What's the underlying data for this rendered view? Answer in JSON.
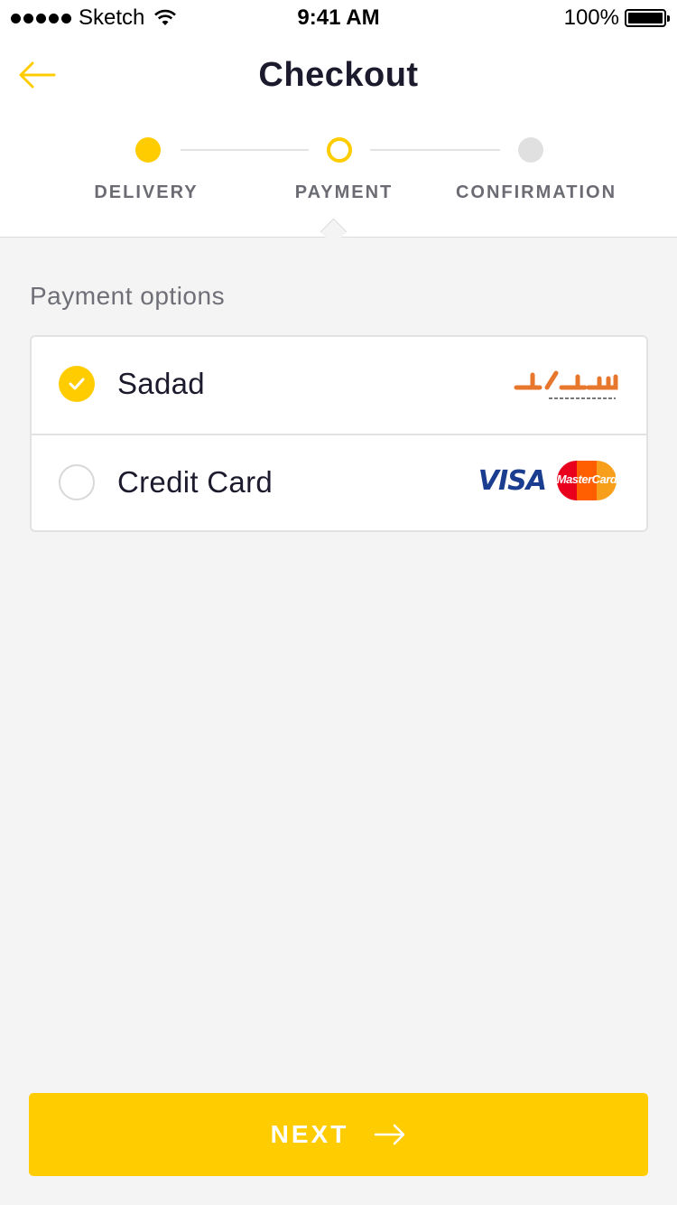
{
  "status_bar": {
    "carrier": "Sketch",
    "time": "9:41 AM",
    "battery": "100%"
  },
  "header": {
    "title": "Checkout"
  },
  "steps": [
    {
      "label": "DELIVERY",
      "state": "done"
    },
    {
      "label": "PAYMENT",
      "state": "active"
    },
    {
      "label": "CONFIRMATION",
      "state": "todo"
    }
  ],
  "payment": {
    "section_title": "Payment options",
    "options": [
      {
        "label": "Sadad",
        "selected": true,
        "logo": "sadad-logo"
      },
      {
        "label": "Credit Card",
        "selected": false,
        "logo": "visa-mastercard-logos",
        "visa_text": "VISA",
        "mastercard_text": "MasterCard"
      }
    ]
  },
  "footer": {
    "next_label": "NEXT"
  },
  "colors": {
    "accent": "#ffcc00",
    "text": "#1c1b2e",
    "muted": "#6b6b73",
    "background": "#f4f4f4"
  }
}
